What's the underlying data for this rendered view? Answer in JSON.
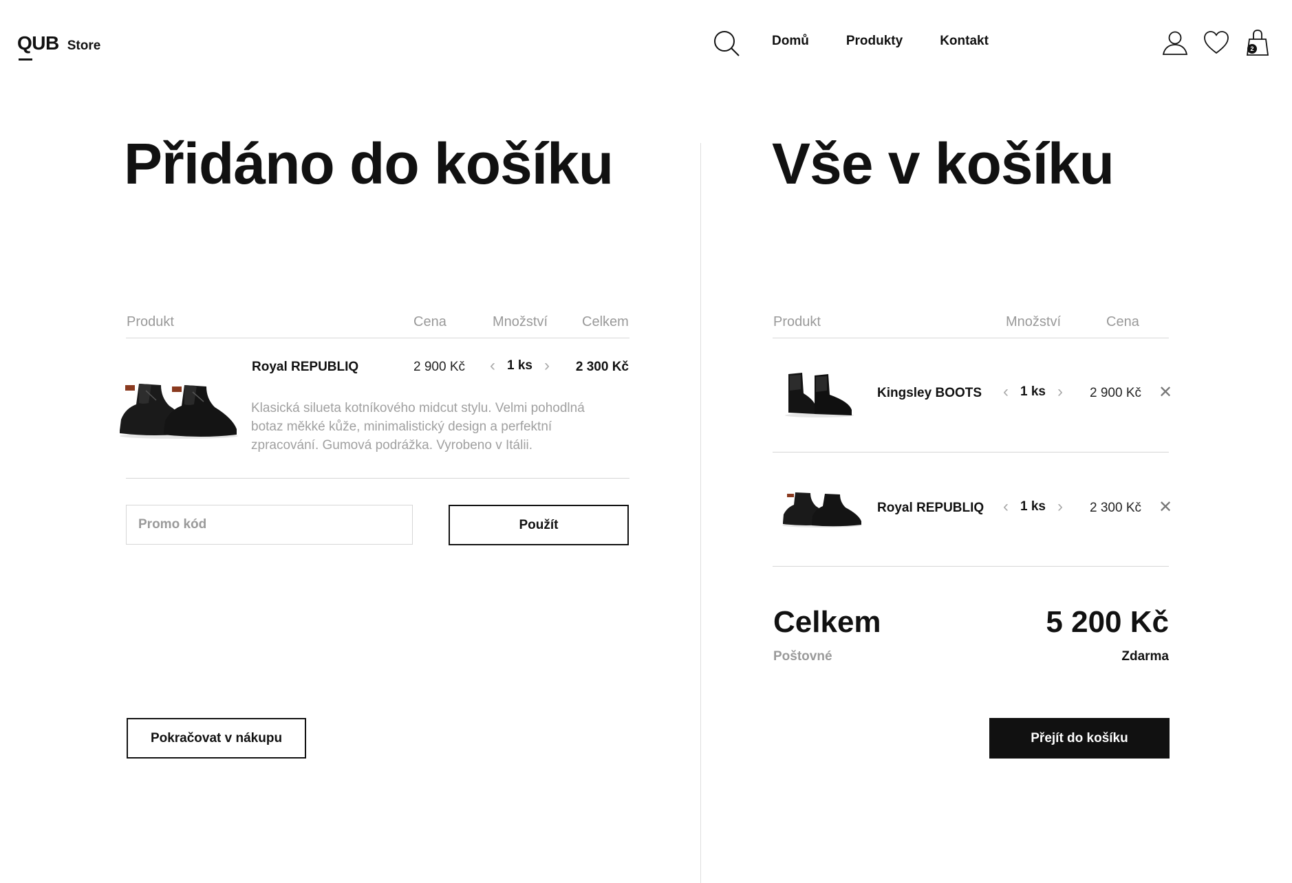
{
  "header": {
    "logo_mark": "QUB",
    "logo_store": "Store",
    "nav": [
      "Domů",
      "Produkty",
      "Kontakt"
    ],
    "cart_count": "2"
  },
  "added": {
    "title": "Přidáno do košíku",
    "columns": {
      "product": "Produkt",
      "price": "Cena",
      "quantity": "Množství",
      "total": "Celkem"
    },
    "item": {
      "name": "Royal REPUBLIQ",
      "price": "2 900 Kč",
      "quantity": "1 ks",
      "total": "2 300 Kč",
      "description": "Klasická silueta kotníkového midcut stylu. Velmi pohodlná botaz měkké kůže, minimalistický design a perfektní zpracování. Gumová podrážka. Vyrobeno v Itálii."
    },
    "promo": {
      "placeholder": "Promo kód",
      "apply_label": "Použít"
    },
    "continue_label": "Pokračovat v nákupu"
  },
  "cart": {
    "title": "Vše v košíku",
    "columns": {
      "product": "Produkt",
      "quantity": "Množství",
      "price": "Cena"
    },
    "items": [
      {
        "name": "Kingsley BOOTS",
        "quantity": "1 ks",
        "price": "2 900 Kč"
      },
      {
        "name": "Royal REPUBLIQ",
        "quantity": "1 ks",
        "price": "2 300 Kč"
      }
    ],
    "total_label": "Celkem",
    "total_value": "5 200 Kč",
    "shipping_label": "Poštovné",
    "shipping_value": "Zdarma",
    "checkout_label": "Přejít do košíku"
  }
}
